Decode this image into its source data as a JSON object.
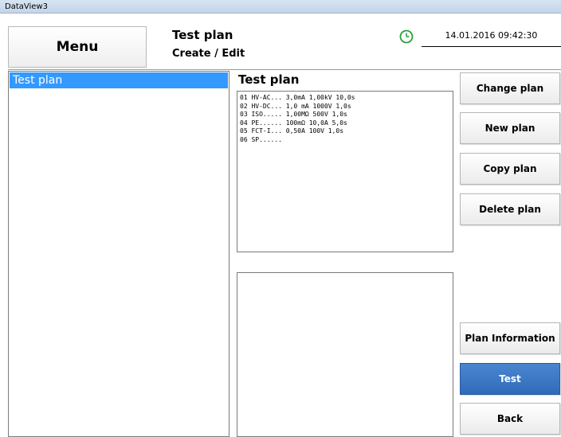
{
  "window": {
    "title": "DataView3"
  },
  "header": {
    "menu_label": "Menu",
    "title": "Test plan",
    "subtitle": "Create / Edit",
    "datetime": "14.01.2016  09:42:30",
    "clock_color": "#2e9e3e"
  },
  "left": {
    "items": [
      {
        "label": "Test plan",
        "selected": true
      }
    ]
  },
  "center": {
    "title": "Test plan",
    "steps": [
      "01 HV-AC... 3,0mA 1,00kV 10,0s",
      "02 HV-DC... 1,0 mA 1000V 1,0s",
      "03 ISO..... 1,00MΩ 500V 1,0s",
      "04 PE...... 100mΩ 10,0A 5,0s",
      "05 FCT-I... 0,50A 100V 1,0s",
      "06 SP......"
    ]
  },
  "buttons": {
    "change_plan": "Change plan",
    "new_plan": "New plan",
    "copy_plan": "Copy plan",
    "delete_plan": "Delete plan",
    "plan_information": "Plan Information",
    "test": "Test",
    "back": "Back"
  },
  "colors": {
    "selection": "#3399ff",
    "active_button": "#3a78c6"
  }
}
